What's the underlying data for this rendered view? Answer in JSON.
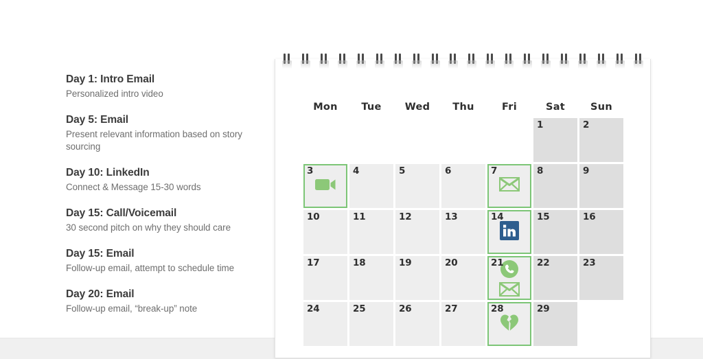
{
  "cadence": {
    "items": [
      {
        "title": "Day 1: Intro Email",
        "desc": "Personalized intro video"
      },
      {
        "title": "Day 5: Email",
        "desc": "Present relevant information based on story sourcing"
      },
      {
        "title": "Day 10: LinkedIn",
        "desc": "Connect & Message 15-30 words"
      },
      {
        "title": "Day 15: Call/Voicemail",
        "desc": "30 second pitch on why they should care"
      },
      {
        "title": "Day 15: Email",
        "desc": "Follow-up email, attempt to schedule time"
      },
      {
        "title": "Day 20: Email",
        "desc": "Follow-up email, “break-up” note"
      }
    ]
  },
  "calendar": {
    "weekdays": [
      "Mon",
      "Tue",
      "Wed",
      "Thu",
      "Fri",
      "Sat",
      "Sun"
    ],
    "spiral_count": 20,
    "colors": {
      "accent_green": "#7cc576",
      "icon_green": "#8cc878",
      "linkedin_blue": "#2d5d8e",
      "weekday_cell": "#eeeeee",
      "weekend_cell": "#dedede"
    },
    "rows": [
      [
        {
          "day": "",
          "type": "empty"
        },
        {
          "day": "",
          "type": "empty"
        },
        {
          "day": "",
          "type": "empty"
        },
        {
          "day": "",
          "type": "empty"
        },
        {
          "day": "",
          "type": "empty"
        },
        {
          "day": "1",
          "type": "weekend"
        },
        {
          "day": "2",
          "type": "weekend"
        }
      ],
      [
        {
          "day": "3",
          "type": "weekday",
          "highlight": true,
          "icons": [
            "video-camera-icon"
          ]
        },
        {
          "day": "4",
          "type": "weekday"
        },
        {
          "day": "5",
          "type": "weekday"
        },
        {
          "day": "6",
          "type": "weekday"
        },
        {
          "day": "7",
          "type": "weekday",
          "highlight": true,
          "icons": [
            "envelope-icon"
          ]
        },
        {
          "day": "8",
          "type": "weekend"
        },
        {
          "day": "9",
          "type": "weekend"
        }
      ],
      [
        {
          "day": "10",
          "type": "weekday"
        },
        {
          "day": "11",
          "type": "weekday"
        },
        {
          "day": "12",
          "type": "weekday"
        },
        {
          "day": "13",
          "type": "weekday"
        },
        {
          "day": "14",
          "type": "weekday",
          "highlight": true,
          "icons": [
            "linkedin-icon"
          ]
        },
        {
          "day": "15",
          "type": "weekend"
        },
        {
          "day": "16",
          "type": "weekend"
        }
      ],
      [
        {
          "day": "17",
          "type": "weekday"
        },
        {
          "day": "18",
          "type": "weekday"
        },
        {
          "day": "19",
          "type": "weekday"
        },
        {
          "day": "20",
          "type": "weekday"
        },
        {
          "day": "21",
          "type": "weekday",
          "highlight": true,
          "icons": [
            "phone-circle-icon",
            "envelope-icon"
          ]
        },
        {
          "day": "22",
          "type": "weekend"
        },
        {
          "day": "23",
          "type": "weekend"
        }
      ],
      [
        {
          "day": "24",
          "type": "weekday"
        },
        {
          "day": "25",
          "type": "weekday"
        },
        {
          "day": "26",
          "type": "weekday"
        },
        {
          "day": "27",
          "type": "weekday"
        },
        {
          "day": "28",
          "type": "weekday",
          "highlight": true,
          "icons": [
            "broken-heart-icon"
          ]
        },
        {
          "day": "29",
          "type": "weekend"
        },
        {
          "day": "",
          "type": "empty"
        }
      ]
    ]
  }
}
